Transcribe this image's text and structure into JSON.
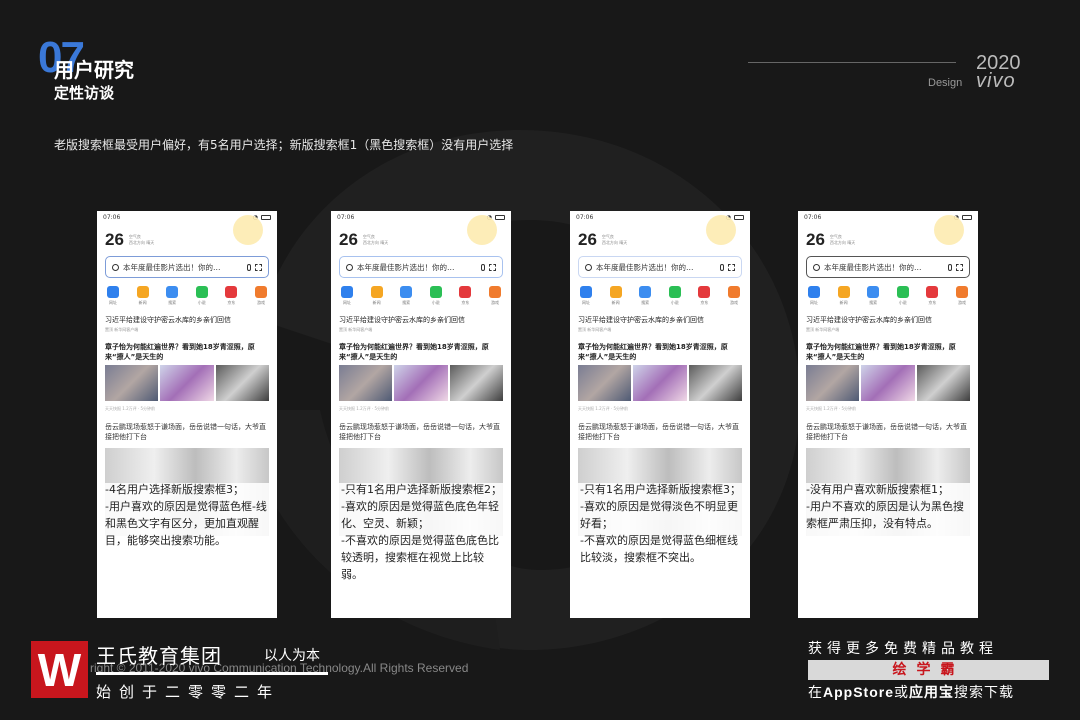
{
  "header": {
    "section_number": "07",
    "title": "用户研究",
    "subtitle": "定性访谈",
    "year": "2020",
    "design_label": "Design",
    "brand": "vivo"
  },
  "intro": "老版搜索框最受用户偏好，有5名用户选择；新版搜索框1（黑色搜索框）没有用户选择",
  "phone_common": {
    "time": "07:06",
    "signal": "▐▌",
    "temperature": "26",
    "weather_line1": "空气良",
    "weather_line2": "西北方向 晴天",
    "search_text": "本年度最佳影片选出！你的…",
    "apps": [
      {
        "label": "网址",
        "color": "#2f80ed"
      },
      {
        "label": "新闻",
        "color": "#f5a623"
      },
      {
        "label": "搜索",
        "color": "#3c8df0"
      },
      {
        "label": "小说",
        "color": "#2bbf55"
      },
      {
        "label": "京东",
        "color": "#e4393c"
      },
      {
        "label": "游戏",
        "color": "#f07b2d"
      }
    ],
    "news1": "习近平给建设守护密云水库的乡亲们回信",
    "news1_meta": "置顶  新华网客户端",
    "news2": "章子怡为何能红遍世界？看到她18岁青涩照，原来“撩人”是天生的",
    "news2_meta": "天天快报  1.2万评 · 5分钟前",
    "news3": "岳云鹏现场惹怒于谦场面，岳岳说错一句话，大爷直接把他打下台"
  },
  "phones": [
    {
      "variant": "v1",
      "note": "-4名用户选择新版搜索框3；\n-用户喜欢的原因是觉得蓝色框-线和黑色文字有区分，更加直观醒目，能够突出搜索功能。"
    },
    {
      "variant": "v2",
      "note": "-只有1名用户选择新版搜索框2；\n-喜欢的原因是觉得蓝色底色年轻化、空灵、新颖；\n-不喜欢的原因是觉得蓝色底色比较透明，搜索框在视觉上比较弱。"
    },
    {
      "variant": "v3",
      "note": "-只有1名用户选择新版搜索框3；\n-喜欢的原因是觉得淡色不明显更好看；\n-不喜欢的原因是觉得蓝色细框线比较淡，搜索框不突出。"
    },
    {
      "variant": "v4",
      "note": "-没有用户喜欢新版搜索框1；\n-用户不喜欢的原因是认为黑色搜索框严肃压抑，没有特点。"
    }
  ],
  "footer": {
    "logo_letter": "W",
    "company": "王氏教育集团",
    "motto": "以人为本",
    "copyright": "right © 2011-2020 vivo Communication Technology.All Rights Reserved",
    "founded": "始创于二零零二年",
    "promo_line1": "获得更多免费精品教程",
    "promo_bar": "绘学霸",
    "promo_line3_pre": "在",
    "promo_line3_store": "AppStore",
    "promo_line3_mid": "或",
    "promo_line3_app": "应用宝",
    "promo_line3_post": "搜索下载"
  }
}
